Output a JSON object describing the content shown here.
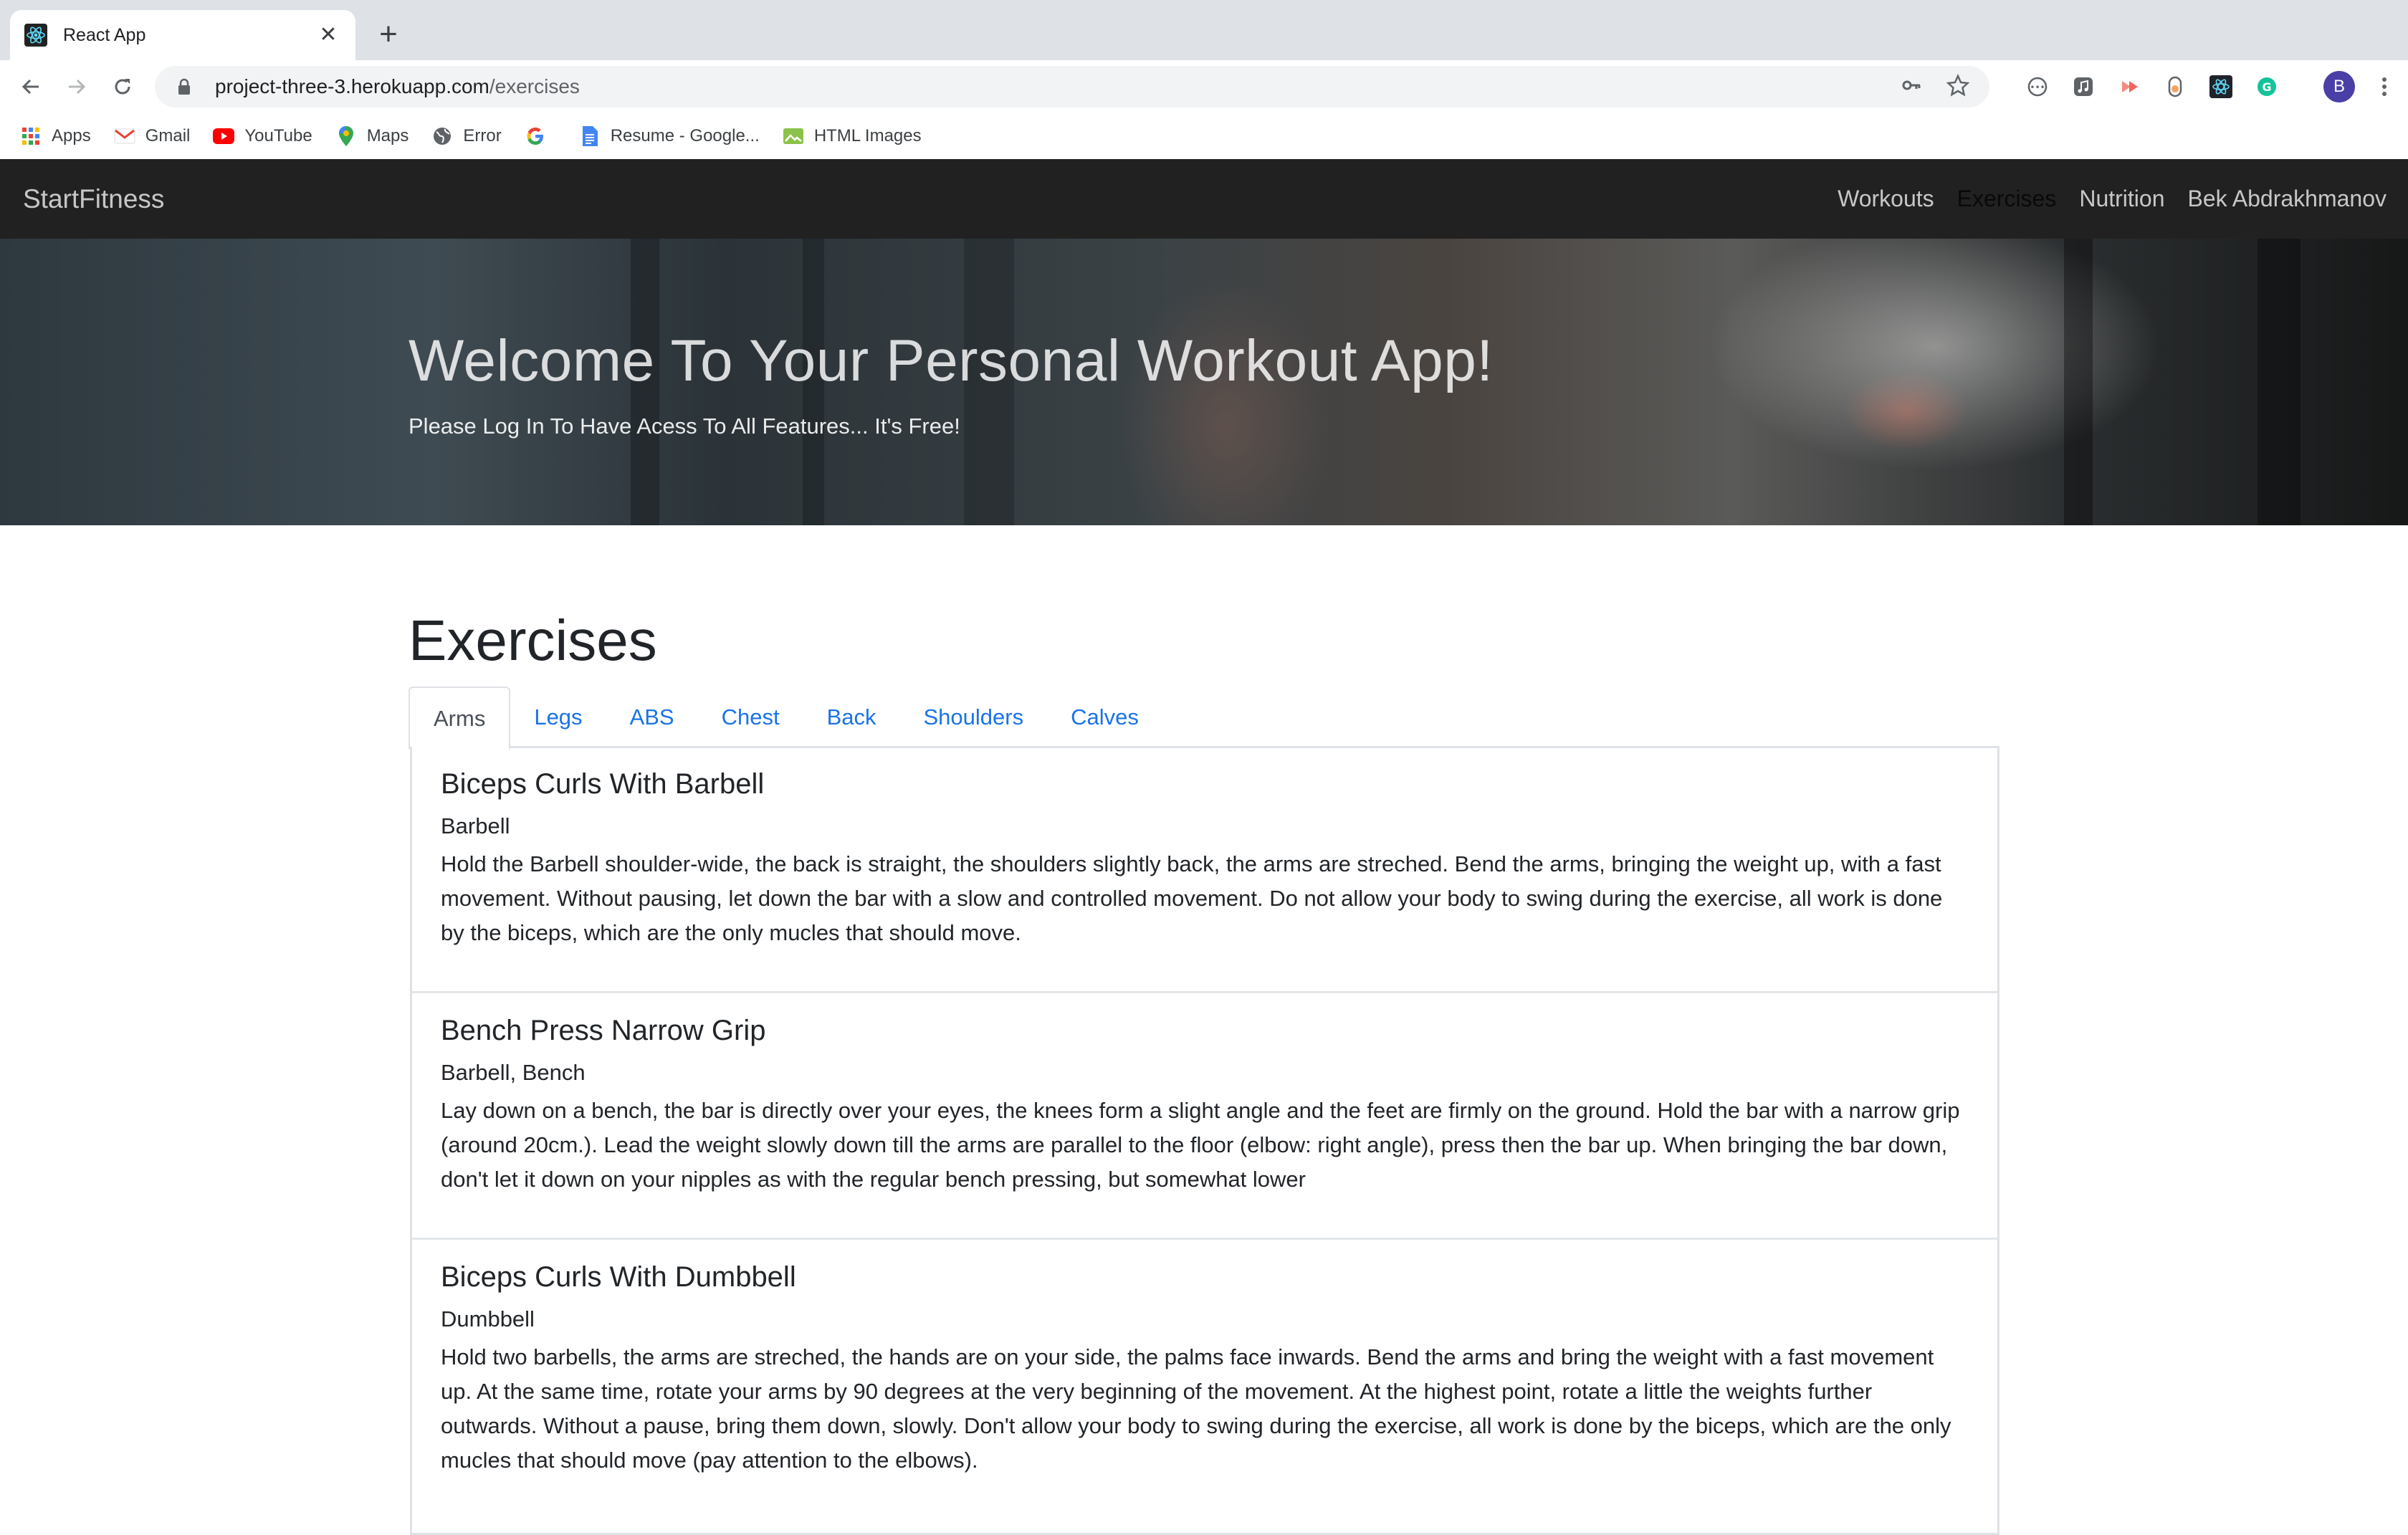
{
  "browser": {
    "tab_title": "React App",
    "url_host": "project-three-3.herokuapp.com",
    "url_path": "/exercises",
    "bookmarks": [
      "Apps",
      "Gmail",
      "YouTube",
      "Maps",
      "Error",
      "",
      "Resume - Google...",
      "HTML Images"
    ],
    "profile_initial": "B"
  },
  "nav": {
    "brand": "StartFitness",
    "links": [
      "Workouts",
      "Exercises",
      "Nutrition",
      "Bek Abdrakhmanov"
    ],
    "active": "Exercises"
  },
  "hero": {
    "title": "Welcome To Your Personal Workout App!",
    "subtitle": "Please Log In To Have Acess To All Features... It's Free!"
  },
  "exercises": {
    "title": "Exercises",
    "tabs": [
      "Arms",
      "Legs",
      "ABS",
      "Chest",
      "Back",
      "Shoulders",
      "Calves"
    ],
    "active_tab": "Arms",
    "items": [
      {
        "name": "Biceps Curls With Barbell",
        "equipment": "Barbell",
        "description": "Hold the Barbell shoulder-wide, the back is straight, the shoulders slightly back, the arms are streched. Bend the arms, bringing the weight up, with a fast movement. Without pausing, let down the bar with a slow and controlled movement. Do not allow your body to swing during the exercise, all work is done by the biceps, which are the only mucles that should move."
      },
      {
        "name": "Bench Press Narrow Grip",
        "equipment": "Barbell, Bench",
        "description": "Lay down on a bench, the bar is directly over your eyes, the knees form a slight angle and the feet are firmly on the ground. Hold the bar with a narrow grip (around 20cm.). Lead the weight slowly down till the arms are parallel to the floor (elbow: right angle), press then the bar up. When bringing the bar down, don't let it down on your nipples as with the regular bench pressing, but somewhat lower"
      },
      {
        "name": "Biceps Curls With Dumbbell",
        "equipment": "Dumbbell",
        "description": "Hold two barbells, the arms are streched, the hands are on your side, the palms face inwards. Bend the arms and bring the weight with a fast movement up. At the same time, rotate your arms by 90 degrees at the very beginning of the movement. At the highest point, rotate a little the weights further outwards. Without a pause, bring them down, slowly. Don't allow your body to swing during the exercise, all work is done by the biceps, which are the only mucles that should move (pay attention to the elbows)."
      }
    ]
  }
}
